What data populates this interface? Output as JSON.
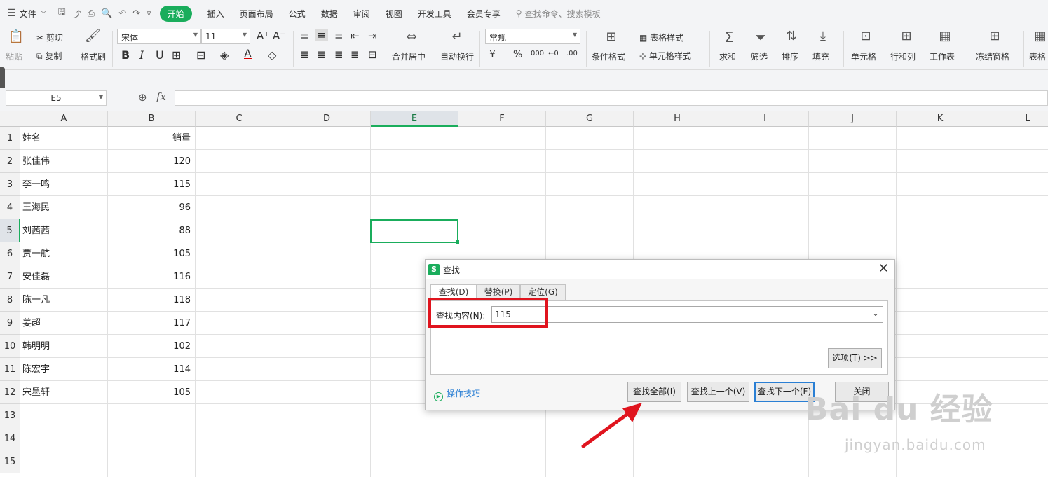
{
  "menubar": {
    "file_label": "文件",
    "tabs": [
      "开始",
      "插入",
      "页面布局",
      "公式",
      "数据",
      "审阅",
      "视图",
      "开发工具",
      "会员专享"
    ],
    "search_placeholder": "查找命令、搜索模板"
  },
  "ribbon": {
    "paste": "粘贴",
    "cut": "剪切",
    "copy": "复制",
    "format_painter": "格式刷",
    "font_name": "宋体",
    "font_size": "11",
    "merge_center": "合并居中",
    "wrap_text": "自动换行",
    "number_format": "常规",
    "conditional_format": "条件格式",
    "table_style": "表格样式",
    "cell_style": "单元格样式",
    "sum": "求和",
    "filter": "筛选",
    "sort": "排序",
    "fill": "填充",
    "cell": "单元格",
    "row_col": "行和列",
    "worksheet": "工作表",
    "freeze": "冻结窗格",
    "table_tools": "表格"
  },
  "formula_bar": {
    "name_box": "E5",
    "fx": "fx"
  },
  "sheet": {
    "columns": [
      "A",
      "B",
      "C",
      "D",
      "E",
      "F",
      "G",
      "H",
      "I",
      "J",
      "K",
      "L"
    ],
    "active_column": "E",
    "active_row": 5,
    "rows": [
      {
        "num": "1",
        "name": "姓名",
        "value": "销量"
      },
      {
        "num": "2",
        "name": "张佳伟",
        "value": "120"
      },
      {
        "num": "3",
        "name": "李一鸣",
        "value": "115"
      },
      {
        "num": "4",
        "name": "王海民",
        "value": "96"
      },
      {
        "num": "5",
        "name": "刘茜茜",
        "value": "88"
      },
      {
        "num": "6",
        "name": "贾一航",
        "value": "105"
      },
      {
        "num": "7",
        "name": "安佳磊",
        "value": "116"
      },
      {
        "num": "8",
        "name": "陈一凡",
        "value": "118"
      },
      {
        "num": "9",
        "name": "姜超",
        "value": "117"
      },
      {
        "num": "10",
        "name": "韩明明",
        "value": "102"
      },
      {
        "num": "11",
        "name": "陈宏宇",
        "value": "114"
      },
      {
        "num": "12",
        "name": "宋墨轩",
        "value": "105"
      },
      {
        "num": "13",
        "name": "",
        "value": ""
      },
      {
        "num": "14",
        "name": "",
        "value": ""
      },
      {
        "num": "15",
        "name": "",
        "value": ""
      }
    ]
  },
  "dialog": {
    "logo": "S",
    "title": "查找",
    "tabs": [
      "查找(D)",
      "替换(P)",
      "定位(G)"
    ],
    "find_label": "查找内容(N):",
    "find_value": "115",
    "options_button": "选项(T) >>",
    "tips_link": "操作技巧",
    "buttons": {
      "find_all": "查找全部(I)",
      "find_prev": "查找上一个(V)",
      "find_next": "查找下一个(F)",
      "close": "关闭"
    }
  },
  "watermark": {
    "brand": "Bai du 经验",
    "url": "jingyan.baidu.com"
  },
  "colors": {
    "accent": "#1aad5c",
    "highlight": "#e0141e",
    "link": "#2a7fd4"
  }
}
